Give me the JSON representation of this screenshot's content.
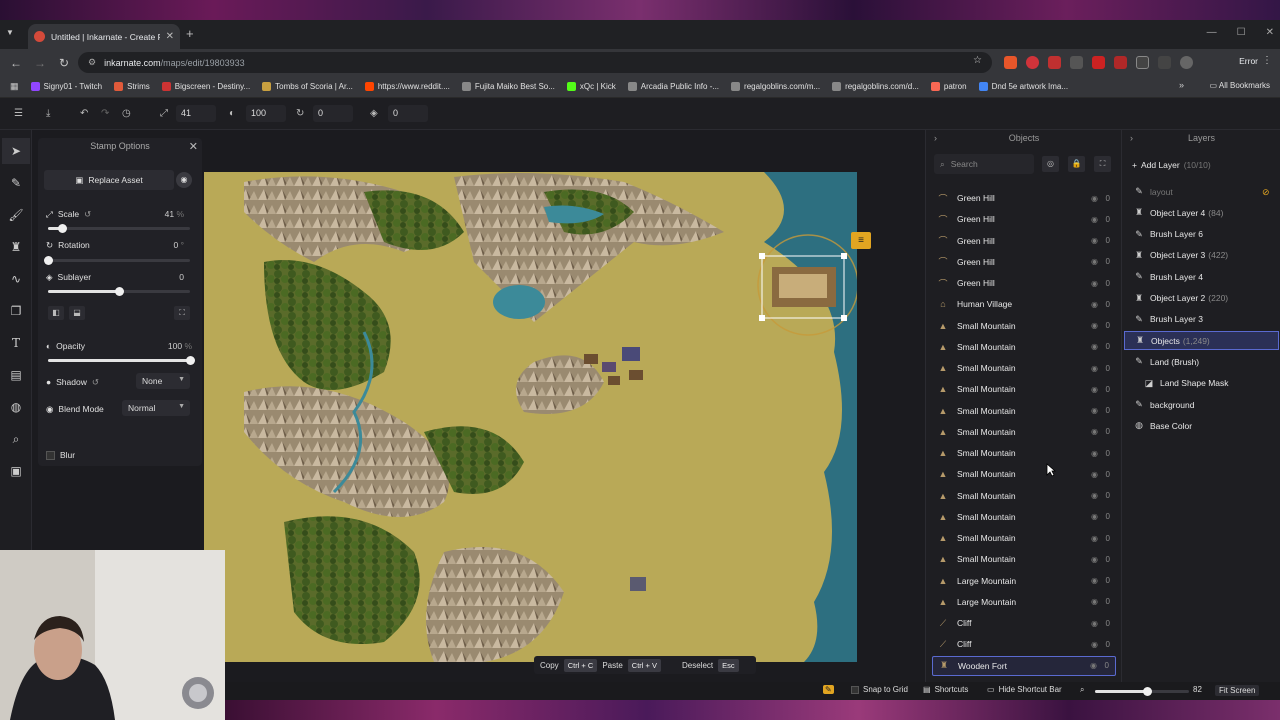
{
  "browser": {
    "tab_title": "Untitled | Inkarnate - Create Fa",
    "url_host": "inkarnate.com",
    "url_path": "/maps/edit/19803933",
    "error_label": "Error",
    "all_bookmarks": "All Bookmarks",
    "bookmarks": [
      {
        "label": "Signy01 - Twitch",
        "color": "#9146ff"
      },
      {
        "label": "Strims",
        "color": "#e05a3a"
      },
      {
        "label": "Bigscreen - Destiny...",
        "color": "#cc3333"
      },
      {
        "label": "Tombs of Scoria | Ar...",
        "color": "#c8a040"
      },
      {
        "label": "https://www.reddit....",
        "color": "#ff4500"
      },
      {
        "label": "Fujita Maiko Best So...",
        "color": "#888888"
      },
      {
        "label": "xQc | Kick",
        "color": "#53fc18"
      },
      {
        "label": "Arcadia Public Info -...",
        "color": "#888888"
      },
      {
        "label": "regalgoblins.com/m...",
        "color": "#888888"
      },
      {
        "label": "regalgoblins.com/d...",
        "color": "#888888"
      },
      {
        "label": "patron",
        "color": "#f96854"
      },
      {
        "label": "Dnd 5e artwork Ima...",
        "color": "#4285f4"
      }
    ]
  },
  "toolbar": {
    "scale_value": "41",
    "opacity_value": "100",
    "rotation_value": "0",
    "sublayer_value": "0"
  },
  "stamp": {
    "header": "Stamp Options",
    "replace_label": "Replace Asset",
    "scale_label": "Scale",
    "scale_value": "41",
    "scale_unit": "%",
    "scale_fraction": 0.1,
    "rotation_label": "Rotation",
    "rotation_value": "0",
    "rotation_unit": "°",
    "rotation_fraction": 0.0,
    "sublayer_label": "Sublayer",
    "sublayer_value": "0",
    "sublayer_fraction": 0.5,
    "opacity_label": "Opacity",
    "opacity_value": "100",
    "opacity_unit": "%",
    "opacity_fraction": 1.0,
    "shadow_label": "Shadow",
    "shadow_value": "None",
    "blend_label": "Blend Mode",
    "blend_value": "Normal",
    "blur_label": "Blur"
  },
  "canvas": {
    "copy_label": "Copy",
    "copy_kbd": "Ctrl + C",
    "paste_label": "Paste",
    "paste_kbd": "Ctrl + V",
    "deselect_label": "Deselect",
    "deselect_kbd": "Esc"
  },
  "objects": {
    "title": "Objects",
    "search_placeholder": "Search",
    "items": [
      {
        "label": "Green Hill",
        "count": "0",
        "icon": "hill-icon"
      },
      {
        "label": "Green Hill",
        "count": "0",
        "icon": "hill-icon"
      },
      {
        "label": "Green Hill",
        "count": "0",
        "icon": "hill-icon"
      },
      {
        "label": "Green Hill",
        "count": "0",
        "icon": "hill-icon"
      },
      {
        "label": "Green Hill",
        "count": "0",
        "icon": "hill-icon"
      },
      {
        "label": "Human Village",
        "count": "0",
        "icon": "village-icon"
      },
      {
        "label": "Small Mountain",
        "count": "0",
        "icon": "mountain-icon"
      },
      {
        "label": "Small Mountain",
        "count": "0",
        "icon": "mountain-icon"
      },
      {
        "label": "Small Mountain",
        "count": "0",
        "icon": "mountain-icon"
      },
      {
        "label": "Small Mountain",
        "count": "0",
        "icon": "mountain-icon"
      },
      {
        "label": "Small Mountain",
        "count": "0",
        "icon": "mountain-icon"
      },
      {
        "label": "Small Mountain",
        "count": "0",
        "icon": "mountain-icon"
      },
      {
        "label": "Small Mountain",
        "count": "0",
        "icon": "mountain-icon"
      },
      {
        "label": "Small Mountain",
        "count": "0",
        "icon": "mountain-icon"
      },
      {
        "label": "Small Mountain",
        "count": "0",
        "icon": "mountain-icon"
      },
      {
        "label": "Small Mountain",
        "count": "0",
        "icon": "mountain-icon"
      },
      {
        "label": "Small Mountain",
        "count": "0",
        "icon": "mountain-icon"
      },
      {
        "label": "Small Mountain",
        "count": "0",
        "icon": "mountain-icon"
      },
      {
        "label": "Large Mountain",
        "count": "0",
        "icon": "mountain-icon"
      },
      {
        "label": "Large Mountain",
        "count": "0",
        "icon": "mountain-icon"
      },
      {
        "label": "Cliff",
        "count": "0",
        "icon": "cliff-icon"
      },
      {
        "label": "Cliff",
        "count": "0",
        "icon": "cliff-icon"
      },
      {
        "label": "Wooden Fort",
        "count": "0",
        "icon": "fort-icon",
        "selected": true
      }
    ]
  },
  "layers": {
    "title": "Layers",
    "add_label": "Add Layer",
    "add_count": "(10/10)",
    "items": [
      {
        "label": "layout",
        "count": "",
        "icon": "brush-icon",
        "dim": true
      },
      {
        "label": "Object Layer 4",
        "count": "(84)",
        "icon": "stamp-icon"
      },
      {
        "label": "Brush Layer 6",
        "count": "",
        "icon": "brush-icon"
      },
      {
        "label": "Object Layer 3",
        "count": "(422)",
        "icon": "stamp-icon"
      },
      {
        "label": "Brush Layer 4",
        "count": "",
        "icon": "brush-icon"
      },
      {
        "label": "Object Layer 2",
        "count": "(220)",
        "icon": "stamp-icon"
      },
      {
        "label": "Brush Layer 3",
        "count": "",
        "icon": "brush-icon"
      },
      {
        "label": "Objects",
        "count": "(1,249)",
        "icon": "stamp-icon",
        "selected": true
      },
      {
        "label": "Land (Brush)",
        "count": "",
        "icon": "brush-icon"
      },
      {
        "label": "Land Shape Mask",
        "count": "",
        "icon": "mask-icon",
        "indent": true
      },
      {
        "label": "background",
        "count": "",
        "icon": "brush-icon"
      },
      {
        "label": "Base Color",
        "count": "",
        "icon": "palette-icon"
      }
    ]
  },
  "status": {
    "snap_label": "Snap to Grid",
    "shortcuts_label": "Shortcuts",
    "hide_shortcut_label": "Hide Shortcut Bar",
    "zoom_value": "82",
    "zoom_fraction": 0.55,
    "fit_label": "Fit Screen"
  },
  "colors": {
    "accent": "#5a6ad0",
    "land": "#b9a957",
    "water": "#2d6f80",
    "highlight": "#e2a521"
  }
}
